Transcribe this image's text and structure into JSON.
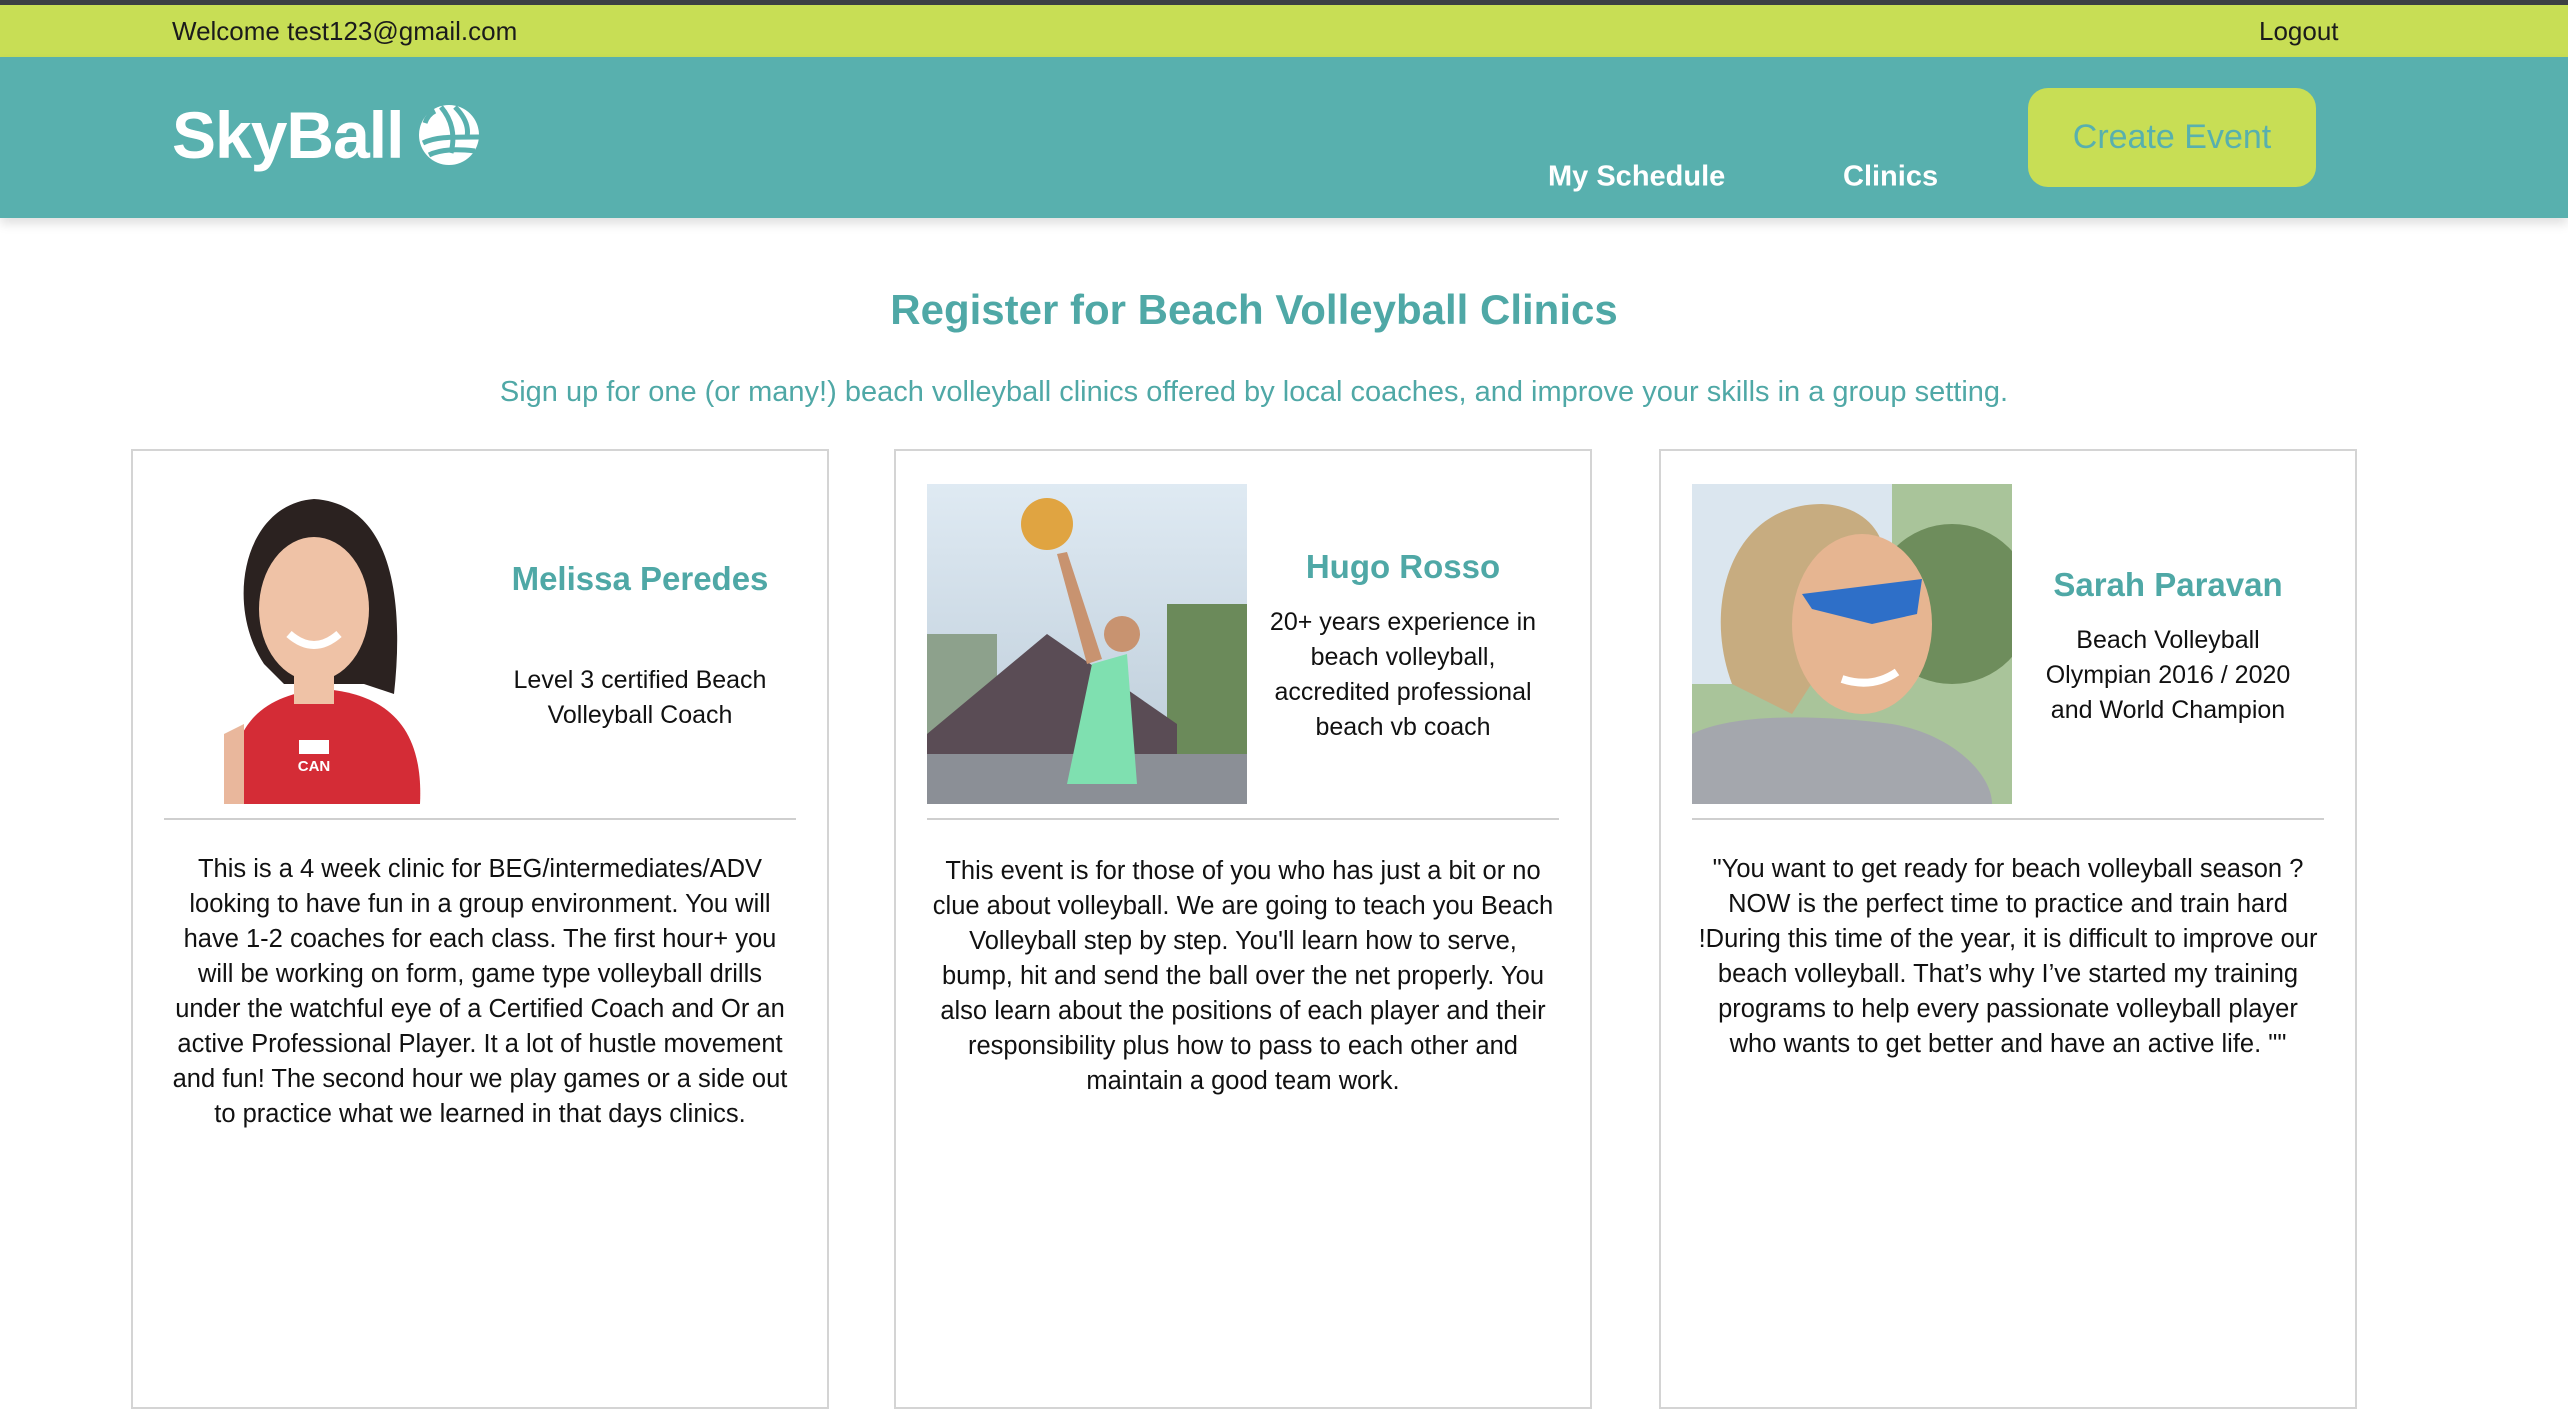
{
  "topbar": {
    "welcome": "Welcome test123@gmail.com",
    "logout": "Logout"
  },
  "header": {
    "logo": "SkyBall",
    "nav": {
      "my_schedule": "My Schedule",
      "clinics": "Clinics",
      "create_event": "Create Event"
    }
  },
  "main": {
    "title": "Register for Beach Volleyball Clinics",
    "subtitle": "Sign up for one (or many!) beach volleyball clinics offered by local coaches, and improve your skills in a group setting.",
    "clinics": [
      {
        "name": "Melissa Peredes",
        "bio": "Level 3 certified Beach Volleyball Coach",
        "shirt_text": "CAN",
        "description": "This is a 4 week clinic for BEG/intermediates/ADV looking to have fun in a group environment. You will have 1-2 coaches for each class. The first hour+ you will be working on form, game type volleyball drills under the watchful eye of a Certified Coach and Or an active Professional Player. It a lot of hustle movement and fun! The second hour we play games or a side out to practice what we learned in that days clinics."
      },
      {
        "name": "Hugo Rosso",
        "bio": "20+ years experience in beach volleyball, accredited professional beach vb coach",
        "description": "This event is for those of you who has just a bit or no clue about volleyball. We are going to teach you Beach Volleyball step by step. You'll learn how to serve, bump, hit and send the ball over the net properly. You also learn about the positions of each player and their responsibility plus how to pass to each other and maintain a good team work."
      },
      {
        "name": "Sarah Paravan",
        "bio": "Beach Volleyball Olympian 2016 / 2020 and World Champion",
        "description": "\"You want to get ready for beach volleyball season ? NOW is the perfect time to practice and train hard !During this time of the year, it is difficult to improve our beach volleyball. That’s why I’ve started my training programs to help every passionate volleyball player who wants to get better and have an active life. \"\""
      }
    ]
  },
  "colors": {
    "lime": "#c8de55",
    "teal": "#58b0ae",
    "heading": "#4fa8a6"
  }
}
